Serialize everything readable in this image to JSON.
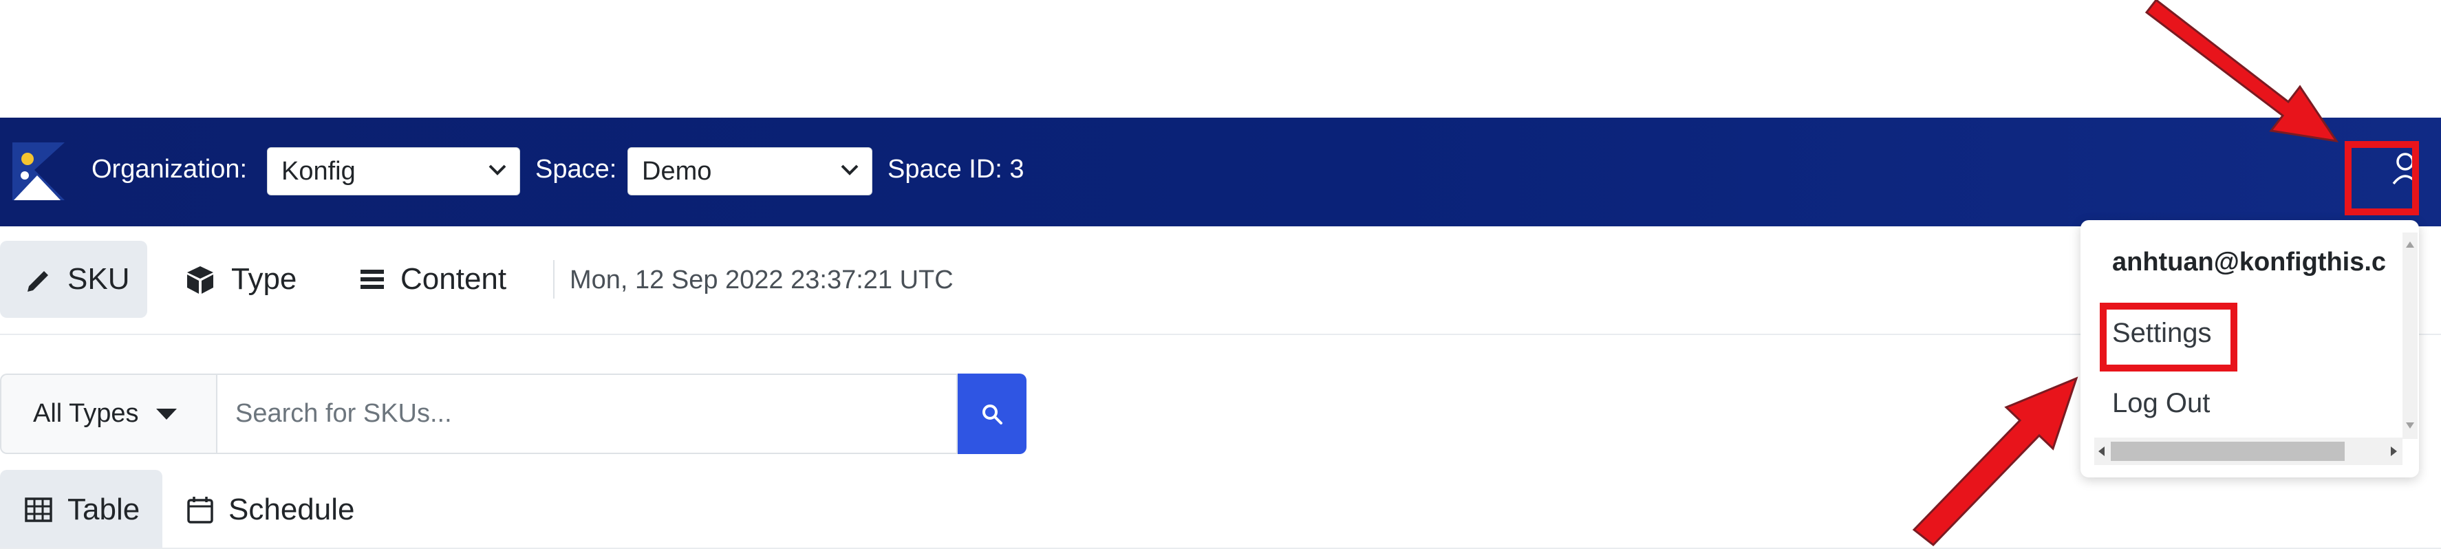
{
  "navbar": {
    "logo_icon": "konfig-logo-icon",
    "organization_label": "Organization:",
    "organization_value": "Konfig",
    "space_label": "Space:",
    "space_value": "Demo",
    "space_id_label": "Space ID: 3",
    "user_icon": "user-icon"
  },
  "toolbar": {
    "sku_label": "SKU",
    "type_label": "Type",
    "content_label": "Content",
    "timestamp": "Mon, 12 Sep 2022 23:37:21 UTC"
  },
  "search": {
    "type_filter": "All Types",
    "placeholder": "Search for SKUs..."
  },
  "view_tabs": {
    "table_label": "Table",
    "schedule_label": "Schedule"
  },
  "user_menu": {
    "email": "anhtuan@konfigthis.c",
    "settings_label": "Settings",
    "logout_label": "Log Out"
  },
  "colors": {
    "navbar": "#0b1f6e",
    "accent": "#2f55e3",
    "annotation": "#e8141b"
  }
}
